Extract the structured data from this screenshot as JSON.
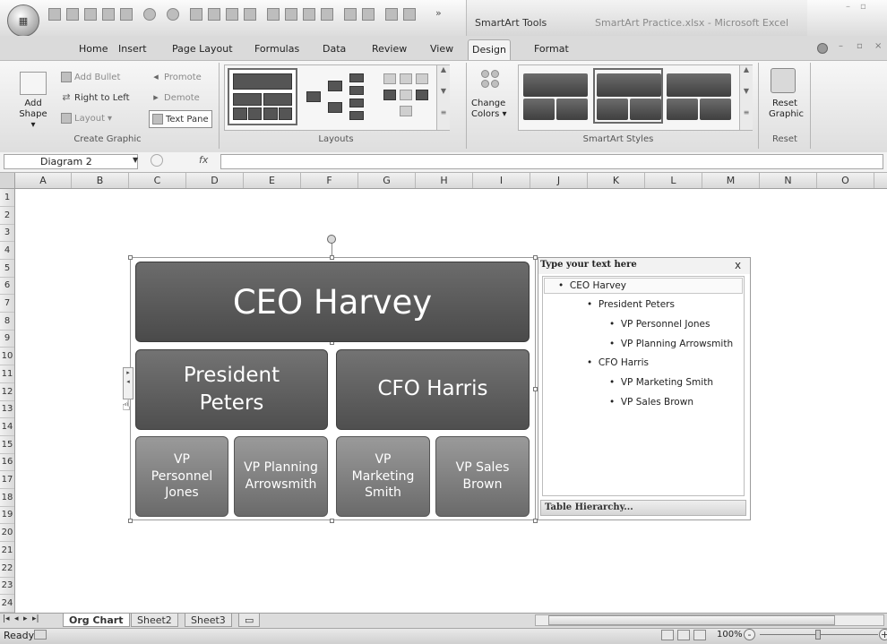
{
  "window": {
    "app_title": "SmartArt Practice.xlsx - Microsoft Excel",
    "contextual_label": "SmartArt Tools",
    "office_button": "Office"
  },
  "tabs": [
    "Home",
    "Insert",
    "Page Layout",
    "Formulas",
    "Data",
    "Review",
    "View",
    "Design",
    "Format"
  ],
  "active_tab": "Design",
  "ribbon": {
    "create_graphic": {
      "label": "Create Graphic",
      "add_shape": "Add Shape",
      "add_shape_line1": "Add",
      "add_shape_line2": "Shape",
      "add_bullet": "Add Bullet",
      "right_to_left": "Right to Left",
      "layout": "Layout",
      "promote": "Promote",
      "demote": "Demote",
      "text_pane": "Text Pane"
    },
    "layouts": {
      "label": "Layouts"
    },
    "smartart_styles": {
      "label": "SmartArt Styles",
      "change_colors_line1": "Change",
      "change_colors_line2": "Colors"
    },
    "reset": {
      "label": "Reset",
      "reset_graphic_line1": "Reset",
      "reset_graphic_line2": "Graphic"
    }
  },
  "formula_bar": {
    "name_box": "Diagram 2",
    "fx": "fx",
    "value": ""
  },
  "columns": [
    "A",
    "B",
    "C",
    "D",
    "E",
    "F",
    "G",
    "H",
    "I",
    "J",
    "K",
    "L",
    "M",
    "N",
    "O"
  ],
  "rows": [
    "1",
    "2",
    "3",
    "4",
    "5",
    "6",
    "7",
    "8",
    "9",
    "10",
    "11",
    "12",
    "13",
    "14",
    "15",
    "16",
    "17",
    "18",
    "19",
    "20",
    "21",
    "22",
    "23",
    "24"
  ],
  "org_chart": {
    "ceo": "CEO Harvey",
    "president_line1": "President",
    "president_line2": "Peters",
    "cfo": "CFO Harris",
    "vp1_line1": "VP",
    "vp1_line2": "Personnel",
    "vp1_line3": "Jones",
    "vp2_line1": "VP Planning",
    "vp2_line2": "Arrowsmith",
    "vp3_line1": "VP",
    "vp3_line2": "Marketing",
    "vp3_line3": "Smith",
    "vp4_line1": "VP Sales",
    "vp4_line2": "Brown"
  },
  "text_pane": {
    "title": "Type your text here",
    "close": "x",
    "items": [
      "CEO Harvey",
      "President Peters",
      "VP Personnel Jones",
      "VP Planning Arrowsmith",
      "CFO Harris",
      "VP Marketing Smith",
      "VP Sales Brown"
    ],
    "footer": "Table Hierarchy..."
  },
  "sheet_tabs": [
    "Org Chart",
    "Sheet2",
    "Sheet3"
  ],
  "active_sheet": "Org Chart",
  "status": {
    "ready": "Ready",
    "zoom": "100%",
    "zoom_minus": "-",
    "zoom_plus": "+"
  }
}
